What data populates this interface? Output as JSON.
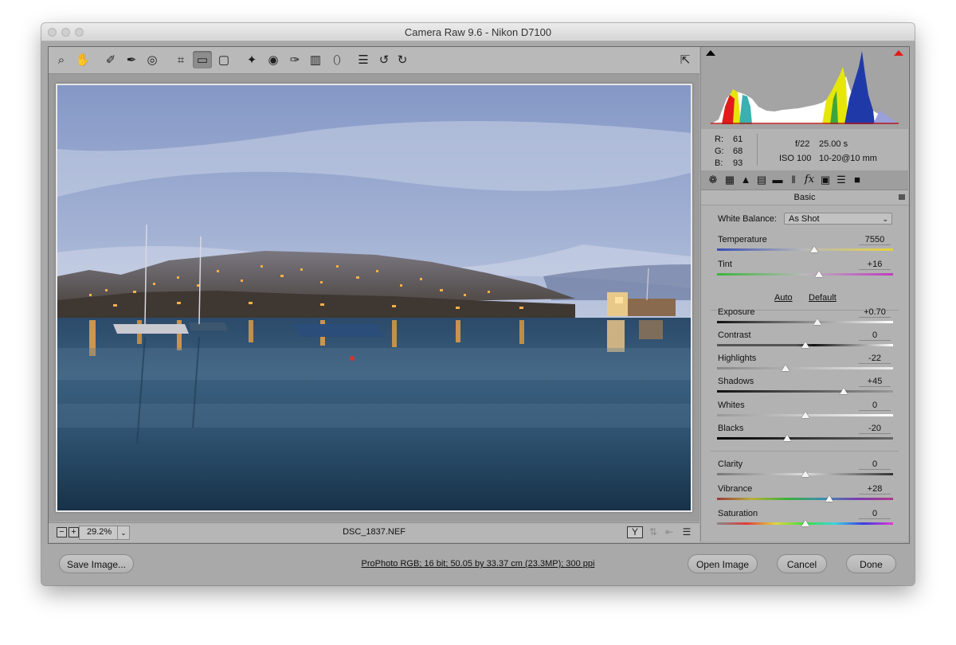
{
  "window": {
    "title": "Camera Raw 9.6  -  Nikon D7100"
  },
  "toolbar": {
    "tools": [
      "zoom-tool",
      "hand-tool",
      "white-balance-tool",
      "color-sampler-tool",
      "targeted-adjustment-tool",
      "crop-tool",
      "straighten-tool",
      "transform-tool",
      "spot-removal-tool",
      "red-eye-tool",
      "adjustment-brush",
      "graduated-filter",
      "radial-filter",
      "preferences",
      "rotate-ccw",
      "rotate-cw"
    ],
    "active_tool": "straighten-tool"
  },
  "histogram": {
    "shadow_clip_color": "#000000",
    "highlight_clip_color": "#e01b1b"
  },
  "info": {
    "r_label": "R:",
    "r_value": "61",
    "g_label": "G:",
    "g_value": "68",
    "b_label": "B:",
    "b_value": "93",
    "aperture": "f/22",
    "shutter": "25.00 s",
    "iso": "ISO 100",
    "lens": "10-20@10 mm"
  },
  "panel": {
    "title": "Basic",
    "white_balance_label": "White Balance:",
    "white_balance_value": "As Shot",
    "auto_label": "Auto",
    "default_label": "Default",
    "sliders": [
      {
        "label": "Temperature",
        "value": "7550",
        "pos": 0.55
      },
      {
        "label": "Tint",
        "value": "+16",
        "pos": 0.58
      },
      {
        "label": "Exposure",
        "value": "+0.70",
        "pos": 0.57
      },
      {
        "label": "Contrast",
        "value": "0",
        "pos": 0.5
      },
      {
        "label": "Highlights",
        "value": "-22",
        "pos": 0.39
      },
      {
        "label": "Shadows",
        "value": "+45",
        "pos": 0.72
      },
      {
        "label": "Whites",
        "value": "0",
        "pos": 0.5
      },
      {
        "label": "Blacks",
        "value": "-20",
        "pos": 0.4
      },
      {
        "label": "Clarity",
        "value": "0",
        "pos": 0.5
      },
      {
        "label": "Vibrance",
        "value": "+28",
        "pos": 0.64
      },
      {
        "label": "Saturation",
        "value": "0",
        "pos": 0.5
      }
    ]
  },
  "status": {
    "zoom": "29.2%",
    "filename": "DSC_1837.NEF"
  },
  "footer": {
    "save_label": "Save Image...",
    "info": "ProPhoto RGB; 16 bit; 50.05 by 33.37 cm (23.3MP); 300 ppi",
    "open_label": "Open Image",
    "cancel_label": "Cancel",
    "done_label": "Done"
  }
}
